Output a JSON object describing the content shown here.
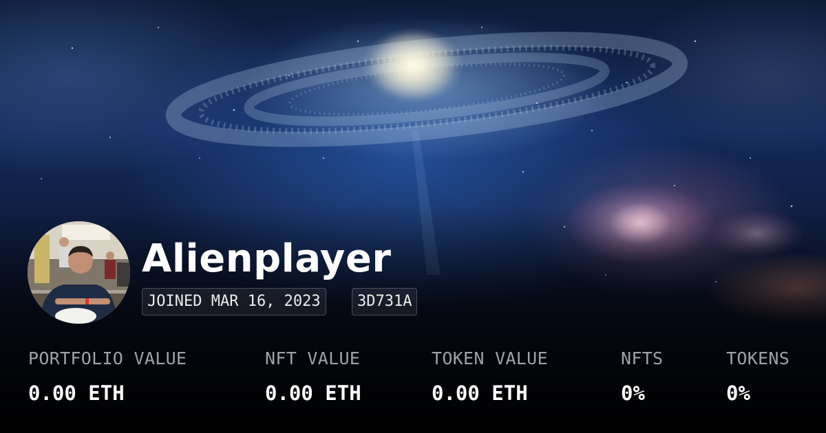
{
  "profile": {
    "name": "Alienplayer",
    "joined": "JOINED MAR 16, 2023",
    "address_tag": "3D731A",
    "avatar": "profile-photo-man-in-restaurant"
  },
  "background": {
    "description_icon": "galaxy-space-banner",
    "colors": {
      "deep": "#0d1a35",
      "mid": "#13295a",
      "bottom": "#05070d"
    }
  },
  "stats": [
    {
      "label": "PORTFOLIO VALUE",
      "value": "0.00 ETH"
    },
    {
      "label": "NFT VALUE",
      "value": "0.00 ETH"
    },
    {
      "label": "TOKEN VALUE",
      "value": "0.00 ETH"
    },
    {
      "label": "NFTS",
      "value": "0%"
    },
    {
      "label": "TOKENS",
      "value": "0%"
    }
  ],
  "colors": {
    "label": "#9da2ad",
    "value": "#ffffff"
  }
}
